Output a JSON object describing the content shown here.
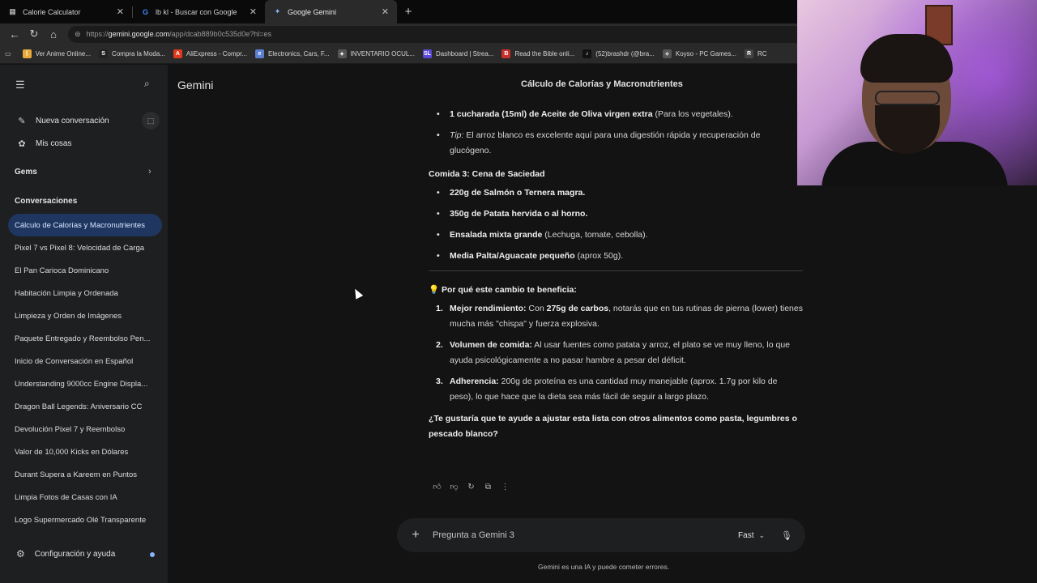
{
  "tabs": [
    {
      "title": "Calorie Calculator",
      "icon": "calculator-icon"
    },
    {
      "title": "lb kl - Buscar con Google",
      "icon": "google-icon"
    },
    {
      "title": "Google Gemini",
      "icon": "gemini-icon"
    }
  ],
  "url": {
    "host": "gemini.google.com",
    "full_prefix": "https://",
    "path": "/app/dcab889b0c535d0e?hl=es"
  },
  "bookmarks": [
    {
      "label": "Ver Anime Online...",
      "color": "#e8a93b",
      "glyph": "ꟾ"
    },
    {
      "label": "Compra la Moda...",
      "color": "#222222",
      "glyph": "S"
    },
    {
      "label": "AliExpress - Compr...",
      "color": "#e03a1e",
      "glyph": "A"
    },
    {
      "label": "Electronics, Cars, F...",
      "color": "#5b7fd1",
      "glyph": "e"
    },
    {
      "label": "INVENTARIO OCUL...",
      "color": "#555555",
      "glyph": "✦"
    },
    {
      "label": "Dashboard | Strea...",
      "color": "#5a49d8",
      "glyph": "SL"
    },
    {
      "label": "Read the Bible onli...",
      "color": "#c9302c",
      "glyph": "B"
    },
    {
      "label": "(52)brashdr (@bra...",
      "color": "#111111",
      "glyph": "♪"
    },
    {
      "label": "Koyso - PC Games...",
      "color": "#555555",
      "glyph": "✧"
    },
    {
      "label": "RC",
      "color": "#444444",
      "glyph": "R"
    }
  ],
  "sidebar": {
    "new_chat": "Nueva conversación",
    "my_stuff": "Mis cosas",
    "gems": "Gems",
    "conversations_heading": "Conversaciones",
    "conversations": [
      "Cálculo de Calorías y Macronutrientes",
      "Pixel 7 vs Pixel 8: Velocidad de Carga",
      "El Pan Carioca Dominicano",
      "Habitación Limpia y Ordenada",
      "Limpieza y Orden de Imágenes",
      "Paquete Entregado y Reembolso Pen...",
      "Inicio de Conversación en Español",
      "Understanding 9000cc Engine Displa...",
      "Dragon Ball Legends: Aniversario CC",
      "Devolución Pixel 7 y Reembolso",
      "Valor de 10,000 Kicks en Dólares",
      "Durant Supera a Kareem en Puntos",
      "Limpia Fotos de Casas con IA",
      "Logo Supermercado Olé Transparente"
    ],
    "active_index": 0,
    "settings": "Configuración y ayuda"
  },
  "main": {
    "brand": "Gemini",
    "title": "Cálculo de Calorías y Macronutrientes",
    "top_bullets": [
      {
        "bold": "1 cucharada (15ml) de Aceite de Oliva virgen extra",
        "rest": " (Para los vegetales)."
      },
      {
        "italic": "Tip:",
        "rest": " El arroz blanco es excelente aquí para una digestión rápida y recuperación de glucógeno."
      }
    ],
    "meal3_heading": "Comida 3: Cena de Saciedad",
    "meal3_items": [
      {
        "bold": "220g de Salmón o Ternera magra.",
        "rest": ""
      },
      {
        "bold": "350g de Patata hervida o al horno.",
        "rest": ""
      },
      {
        "bold": "Ensalada mixta grande",
        "rest": " (Lechuga, tomate, cebolla)."
      },
      {
        "bold": "Media Palta/Aguacate pequeño",
        "rest": " (aprox 50g)."
      }
    ],
    "benefit_heading": "💡 Por qué este cambio te beneficia:",
    "benefits": [
      {
        "num": "1.",
        "bold": "Mejor rendimiento:",
        "pre": " Con ",
        "bold2": "275g de carbos",
        "rest": ", notarás que en tus rutinas de pierna (lower) tienes mucha más \"chispa\" y fuerza explosiva."
      },
      {
        "num": "2.",
        "bold": "Volumen de comida:",
        "pre": " Al usar fuentes como patata y arroz, el plato se ve muy lleno, lo que ayuda psicológicamente a no pasar hambre a pesar del déficit.",
        "bold2": "",
        "rest": ""
      },
      {
        "num": "3.",
        "bold": "Adherencia:",
        "pre": " 200g de proteína es una cantidad muy manejable (aprox. 1.7g por kilo de peso), lo que hace que la dieta sea más fácil de seguir a largo plazo.",
        "bold2": "",
        "rest": ""
      }
    ],
    "question": "¿Te gustaría que te ayude a ajustar esta lista con otros alimentos como pasta, legumbres o pescado blanco?",
    "prompt_placeholder": "Pregunta a Gemini 3",
    "mode": "Fast",
    "disclaimer": "Gemini es una IA y puede cometer errores."
  }
}
